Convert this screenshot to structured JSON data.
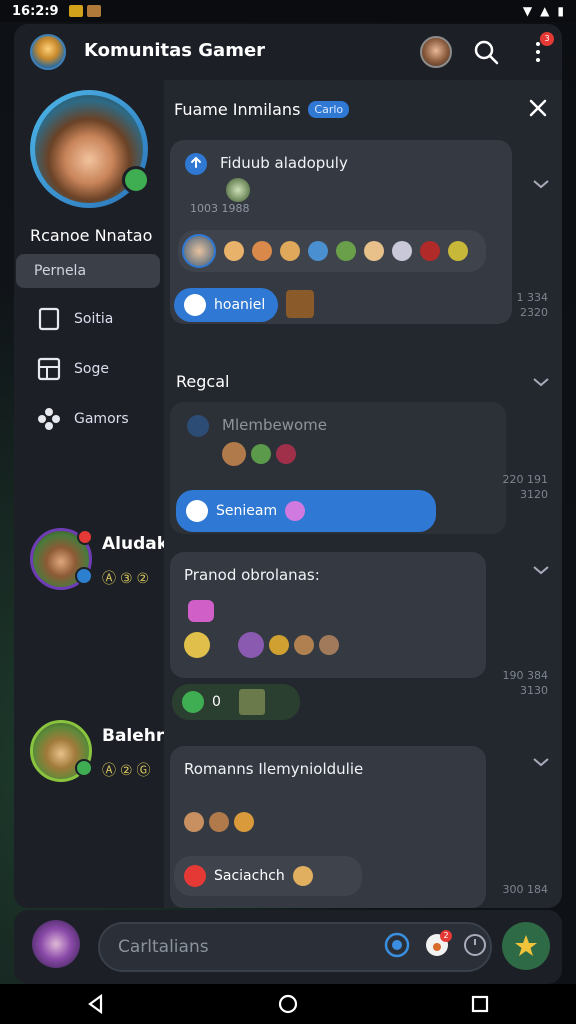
{
  "status_bar": {
    "time": "16:2:9"
  },
  "header": {
    "title": "Komunitas Gamer",
    "notification_count": "3"
  },
  "sidebar": {
    "profile_name": "Rcanoe Nnatao",
    "nav": [
      {
        "label": "Pernela",
        "icon": "none",
        "active": true
      },
      {
        "label": "Soitia",
        "icon": "square-icon"
      },
      {
        "label": "Soge",
        "icon": "layout-icon"
      },
      {
        "label": "Gamors",
        "icon": "gamepad-icon"
      }
    ],
    "members": [
      {
        "name": "Aludak",
        "stats": "Ⓐ③②"
      },
      {
        "name": "Balehr",
        "stats": "Ⓐ②Ⓖ"
      }
    ]
  },
  "content": {
    "title": "Fuame Inmilans",
    "tag": "Carlo",
    "cards": [
      {
        "title": "Fiduub aladopuly",
        "sub": "1003 1988",
        "meta": "1 334\n2320",
        "pill": "hoaniel"
      },
      {
        "section": "Regcal",
        "title": "Mlembewome",
        "meta": "220 191\n3120",
        "pill": "Senieam"
      },
      {
        "title": "Pranod obrolanas:",
        "meta": "190 384\n3130",
        "pill": "0"
      },
      {
        "title": "Romanns Ilemynioldulie",
        "meta": "300 184",
        "pill": "Saciachch"
      }
    ]
  },
  "composer": {
    "placeholder": "Carltalians",
    "notification_count": "2"
  },
  "colors": {
    "accent": "#2f78d3",
    "panel": "#1c2026",
    "card": "#343942",
    "online": "#3fae53"
  }
}
